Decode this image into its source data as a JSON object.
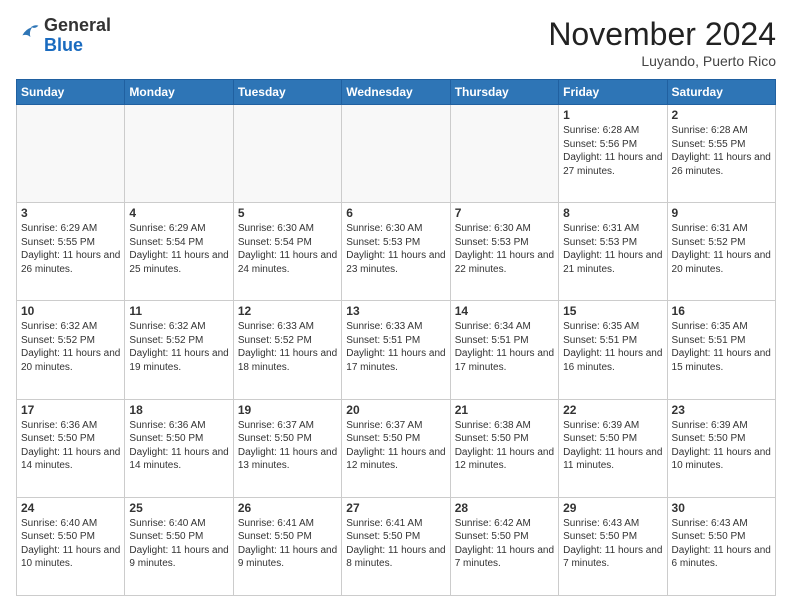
{
  "logo": {
    "general": "General",
    "blue": "Blue"
  },
  "header": {
    "month_title": "November 2024",
    "location": "Luyando, Puerto Rico"
  },
  "weekdays": [
    "Sunday",
    "Monday",
    "Tuesday",
    "Wednesday",
    "Thursday",
    "Friday",
    "Saturday"
  ],
  "weeks": [
    [
      {
        "day": "",
        "empty": true
      },
      {
        "day": "",
        "empty": true
      },
      {
        "day": "",
        "empty": true
      },
      {
        "day": "",
        "empty": true
      },
      {
        "day": "",
        "empty": true
      },
      {
        "day": "1",
        "sunrise": "6:28 AM",
        "sunset": "5:56 PM",
        "daylight": "11 hours and 27 minutes."
      },
      {
        "day": "2",
        "sunrise": "6:28 AM",
        "sunset": "5:55 PM",
        "daylight": "11 hours and 26 minutes."
      }
    ],
    [
      {
        "day": "3",
        "sunrise": "6:29 AM",
        "sunset": "5:55 PM",
        "daylight": "11 hours and 26 minutes."
      },
      {
        "day": "4",
        "sunrise": "6:29 AM",
        "sunset": "5:54 PM",
        "daylight": "11 hours and 25 minutes."
      },
      {
        "day": "5",
        "sunrise": "6:30 AM",
        "sunset": "5:54 PM",
        "daylight": "11 hours and 24 minutes."
      },
      {
        "day": "6",
        "sunrise": "6:30 AM",
        "sunset": "5:53 PM",
        "daylight": "11 hours and 23 minutes."
      },
      {
        "day": "7",
        "sunrise": "6:30 AM",
        "sunset": "5:53 PM",
        "daylight": "11 hours and 22 minutes."
      },
      {
        "day": "8",
        "sunrise": "6:31 AM",
        "sunset": "5:53 PM",
        "daylight": "11 hours and 21 minutes."
      },
      {
        "day": "9",
        "sunrise": "6:31 AM",
        "sunset": "5:52 PM",
        "daylight": "11 hours and 20 minutes."
      }
    ],
    [
      {
        "day": "10",
        "sunrise": "6:32 AM",
        "sunset": "5:52 PM",
        "daylight": "11 hours and 20 minutes."
      },
      {
        "day": "11",
        "sunrise": "6:32 AM",
        "sunset": "5:52 PM",
        "daylight": "11 hours and 19 minutes."
      },
      {
        "day": "12",
        "sunrise": "6:33 AM",
        "sunset": "5:52 PM",
        "daylight": "11 hours and 18 minutes."
      },
      {
        "day": "13",
        "sunrise": "6:33 AM",
        "sunset": "5:51 PM",
        "daylight": "11 hours and 17 minutes."
      },
      {
        "day": "14",
        "sunrise": "6:34 AM",
        "sunset": "5:51 PM",
        "daylight": "11 hours and 17 minutes."
      },
      {
        "day": "15",
        "sunrise": "6:35 AM",
        "sunset": "5:51 PM",
        "daylight": "11 hours and 16 minutes."
      },
      {
        "day": "16",
        "sunrise": "6:35 AM",
        "sunset": "5:51 PM",
        "daylight": "11 hours and 15 minutes."
      }
    ],
    [
      {
        "day": "17",
        "sunrise": "6:36 AM",
        "sunset": "5:50 PM",
        "daylight": "11 hours and 14 minutes."
      },
      {
        "day": "18",
        "sunrise": "6:36 AM",
        "sunset": "5:50 PM",
        "daylight": "11 hours and 14 minutes."
      },
      {
        "day": "19",
        "sunrise": "6:37 AM",
        "sunset": "5:50 PM",
        "daylight": "11 hours and 13 minutes."
      },
      {
        "day": "20",
        "sunrise": "6:37 AM",
        "sunset": "5:50 PM",
        "daylight": "11 hours and 12 minutes."
      },
      {
        "day": "21",
        "sunrise": "6:38 AM",
        "sunset": "5:50 PM",
        "daylight": "11 hours and 12 minutes."
      },
      {
        "day": "22",
        "sunrise": "6:39 AM",
        "sunset": "5:50 PM",
        "daylight": "11 hours and 11 minutes."
      },
      {
        "day": "23",
        "sunrise": "6:39 AM",
        "sunset": "5:50 PM",
        "daylight": "11 hours and 10 minutes."
      }
    ],
    [
      {
        "day": "24",
        "sunrise": "6:40 AM",
        "sunset": "5:50 PM",
        "daylight": "11 hours and 10 minutes."
      },
      {
        "day": "25",
        "sunrise": "6:40 AM",
        "sunset": "5:50 PM",
        "daylight": "11 hours and 9 minutes."
      },
      {
        "day": "26",
        "sunrise": "6:41 AM",
        "sunset": "5:50 PM",
        "daylight": "11 hours and 9 minutes."
      },
      {
        "day": "27",
        "sunrise": "6:41 AM",
        "sunset": "5:50 PM",
        "daylight": "11 hours and 8 minutes."
      },
      {
        "day": "28",
        "sunrise": "6:42 AM",
        "sunset": "5:50 PM",
        "daylight": "11 hours and 7 minutes."
      },
      {
        "day": "29",
        "sunrise": "6:43 AM",
        "sunset": "5:50 PM",
        "daylight": "11 hours and 7 minutes."
      },
      {
        "day": "30",
        "sunrise": "6:43 AM",
        "sunset": "5:50 PM",
        "daylight": "11 hours and 6 minutes."
      }
    ]
  ]
}
